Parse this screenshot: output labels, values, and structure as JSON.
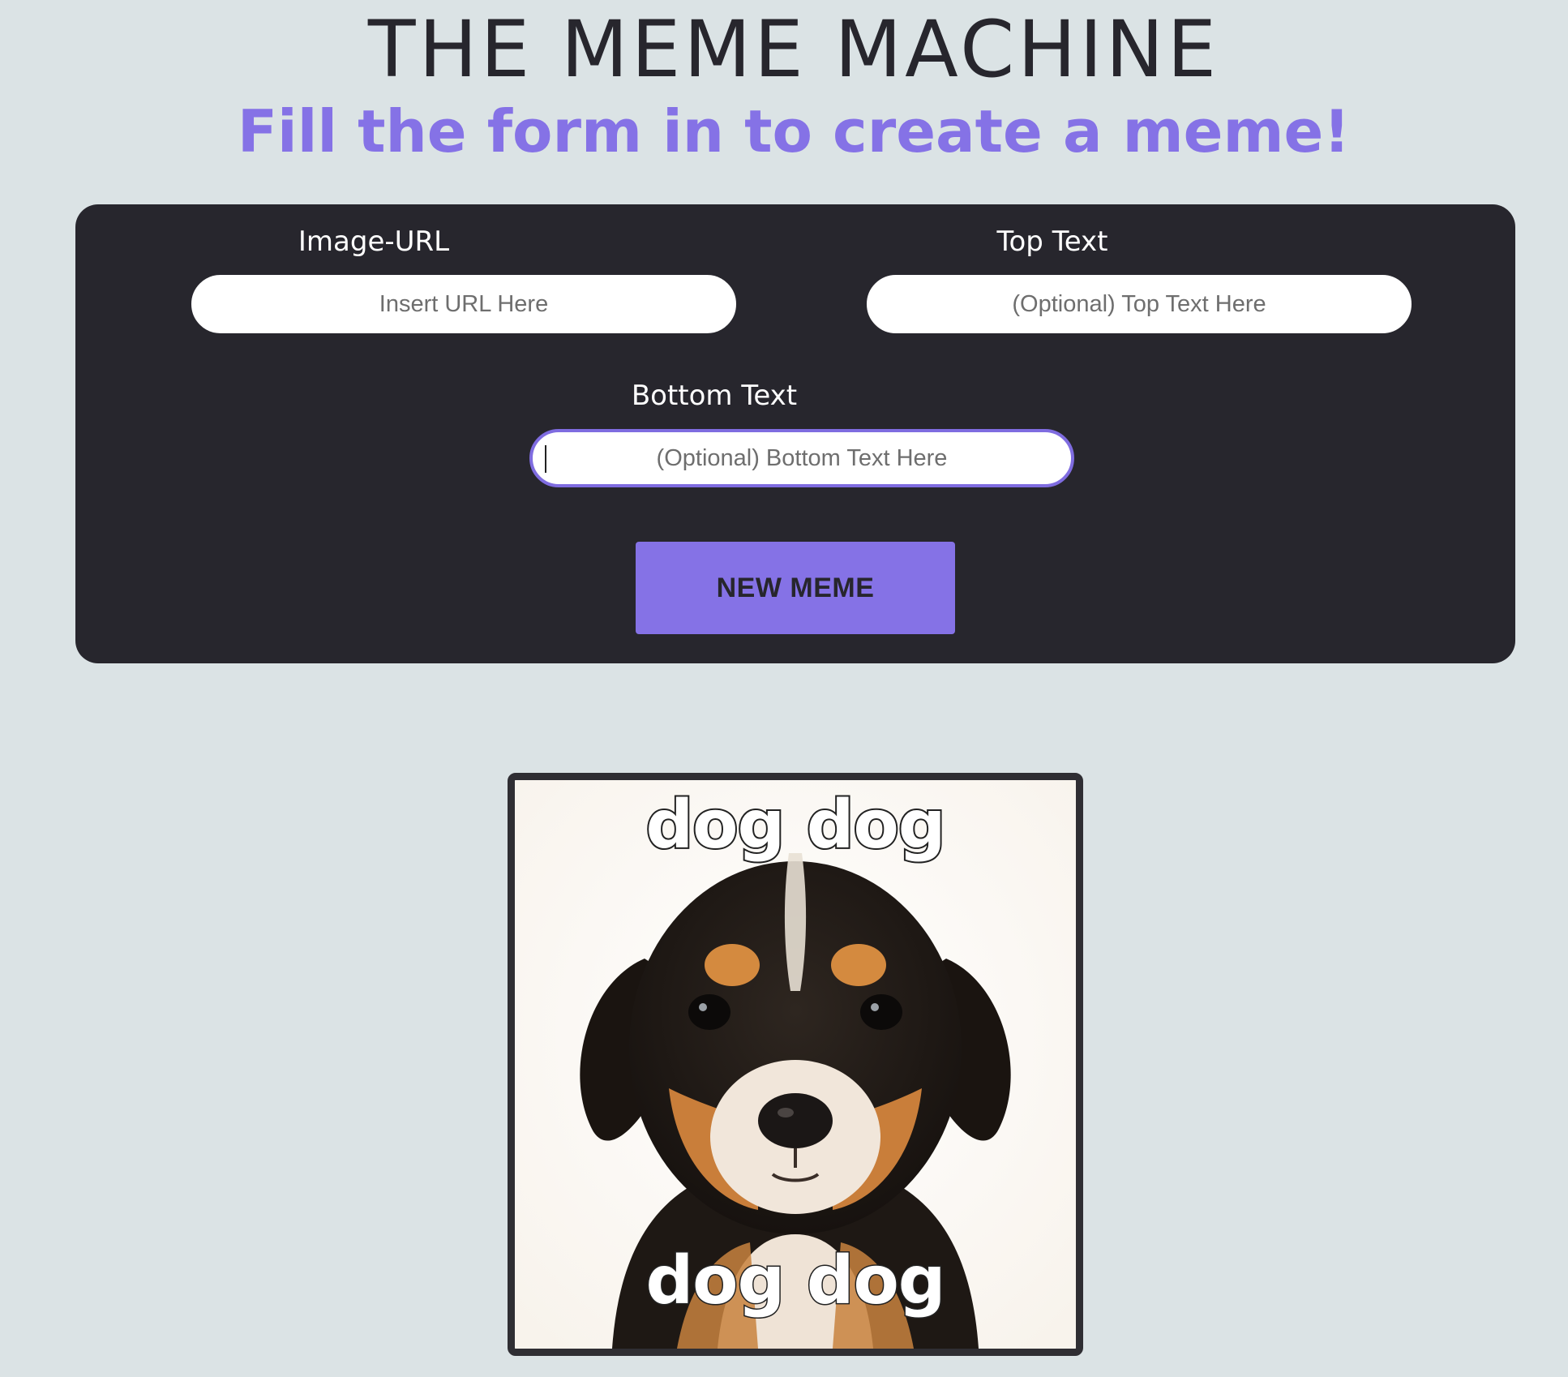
{
  "header": {
    "title": "THE MEME MACHINE",
    "subtitle": "Fill the form in to create a meme!"
  },
  "form": {
    "image_url": {
      "label": "Image-URL",
      "placeholder": "Insert URL Here",
      "value": ""
    },
    "top_text": {
      "label": "Top Text",
      "placeholder": "(Optional) Top Text Here",
      "value": ""
    },
    "bottom_text": {
      "label": "Bottom Text",
      "placeholder": "(Optional) Bottom Text Here",
      "value": ""
    },
    "submit_label": "NEW MEME"
  },
  "meme": {
    "top_text": "dog dog",
    "bottom_text": "dog dog",
    "image_subject": "puppy"
  },
  "colors": {
    "background": "#dbe3e5",
    "panel": "#27262d",
    "accent": "#8572e6",
    "title": "#27262d"
  }
}
